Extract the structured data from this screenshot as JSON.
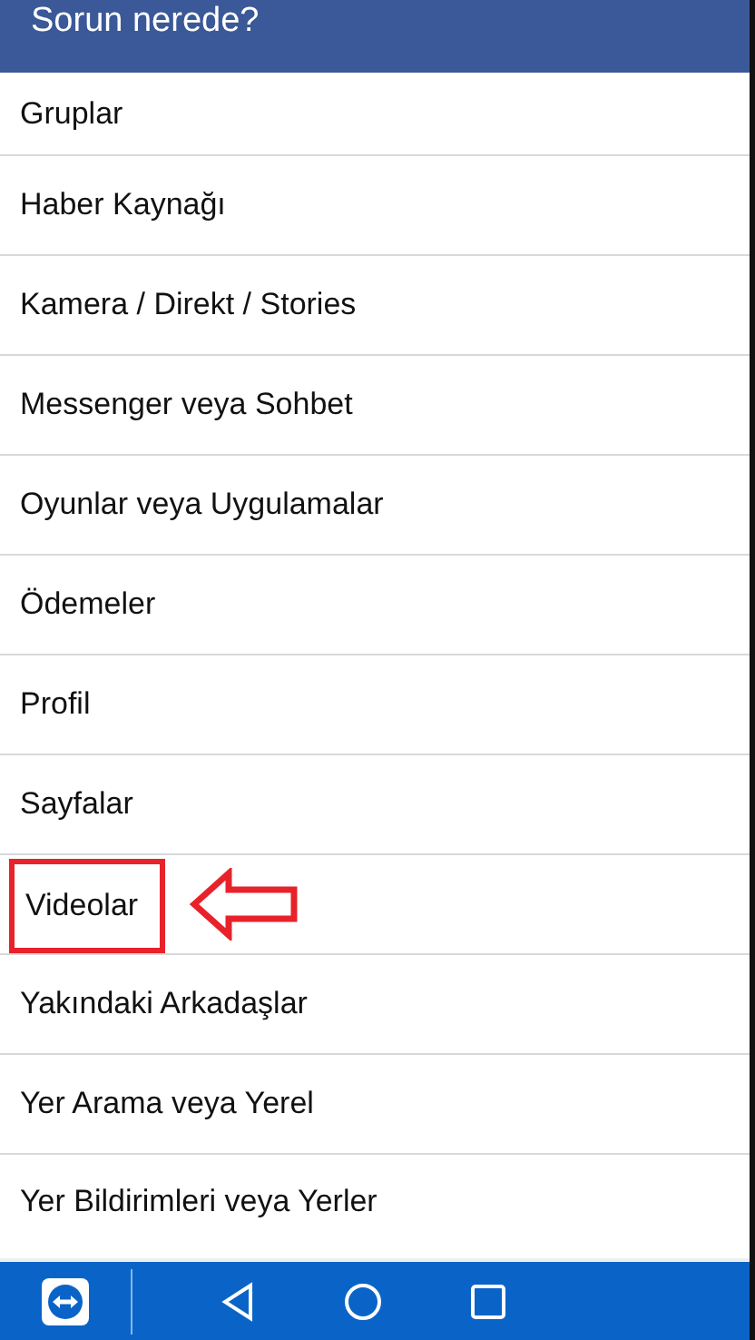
{
  "header": {
    "title": "Sorun nerede?"
  },
  "items": [
    {
      "label": "Gruplar",
      "highlighted": false
    },
    {
      "label": "Haber Kaynağı",
      "highlighted": false
    },
    {
      "label": "Kamera / Direkt / Stories",
      "highlighted": false
    },
    {
      "label": "Messenger veya Sohbet",
      "highlighted": false
    },
    {
      "label": "Oyunlar veya Uygulamalar",
      "highlighted": false
    },
    {
      "label": "Ödemeler",
      "highlighted": false
    },
    {
      "label": "Profil",
      "highlighted": false
    },
    {
      "label": "Sayfalar",
      "highlighted": false
    },
    {
      "label": "Videolar",
      "highlighted": true
    },
    {
      "label": "Yakındaki Arkadaşlar",
      "highlighted": false
    },
    {
      "label": "Yer Arama veya Yerel",
      "highlighted": false
    },
    {
      "label": "Yer Bildirimleri veya Yerler",
      "highlighted": false
    }
  ]
}
